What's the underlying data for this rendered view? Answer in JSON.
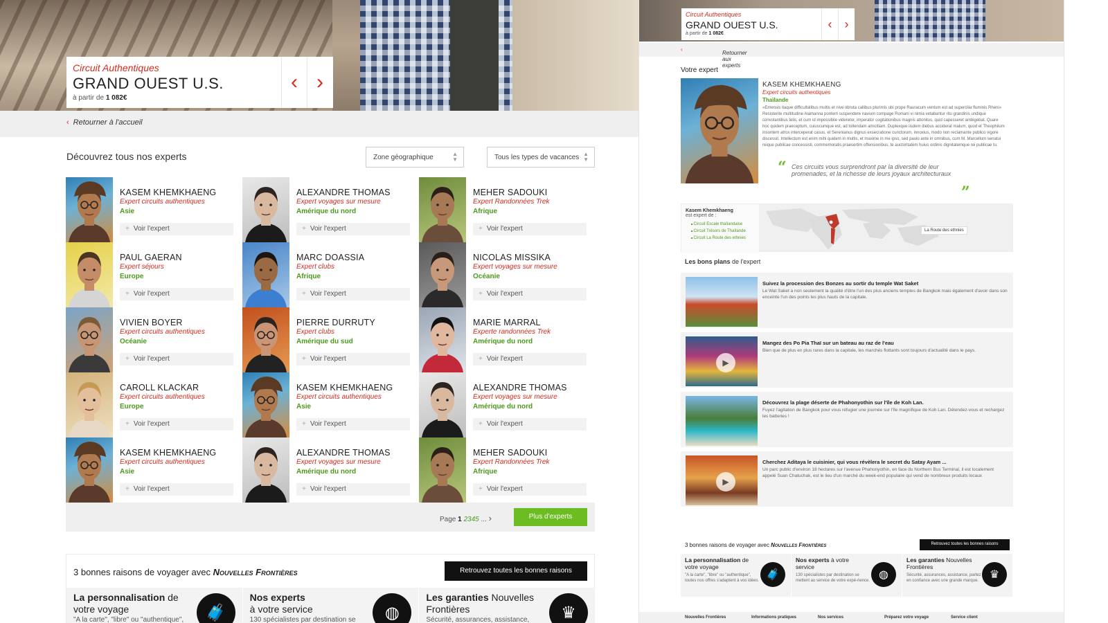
{
  "left": {
    "trip": {
      "kicker": "Circuit Authentiques",
      "title": "GRAND OUEST U.S.",
      "price_prefix": "à partir de",
      "price": "1 082€",
      "prev_icon": "chevron-left-icon",
      "next_icon": "chevron-right-icon"
    },
    "back_label": "Retourner à l'accueil",
    "section_title": "Découvrez tous nos experts",
    "filters": {
      "zone": "Zone géographique",
      "type": "Tous les types de vacances"
    },
    "expert_button": "Voir l'expert",
    "experts": [
      {
        "name": "KASEM KHEMKHAENG",
        "role": "Expert circuits authentiques",
        "zone": "Asie",
        "photo": "kasem"
      },
      {
        "name": "ALEXANDRE THOMAS",
        "role": "Expert voyages sur mesure",
        "zone": "Amérique du nord",
        "photo": "alexandre"
      },
      {
        "name": "MEHER SADOUKI",
        "role": "Expert Randonnées Trek",
        "zone": "Afrique",
        "photo": "meher"
      },
      {
        "name": "PAUL GAERAN",
        "role": "Expert séjours",
        "zone": "Europe",
        "photo": "paul"
      },
      {
        "name": "MARC DOASSIA",
        "role": "Expert clubs",
        "zone": "Afrique",
        "photo": "marc"
      },
      {
        "name": "NICOLAS MISSIKA",
        "role": "Expert voyages sur mesure",
        "zone": "Océanie",
        "photo": "nicolas"
      },
      {
        "name": "VIVIEN BOYER",
        "role": "Expert circuits authentiques",
        "zone": "Océanie",
        "photo": "vivien"
      },
      {
        "name": "PIERRE DURRUTY",
        "role": "Expert clubs",
        "zone": "Amérique du sud",
        "photo": "pierre"
      },
      {
        "name": "MARIE MARRAL",
        "role": "Experte randonnées Trek",
        "zone": "Amérique du nord",
        "photo": "marie"
      },
      {
        "name": "CAROLL KLACKAR",
        "role": "Expert circuits authentiques",
        "zone": "Europe",
        "photo": "caroll"
      },
      {
        "name": "KASEM KHEMKHAENG",
        "role": "Expert circuits authentiques",
        "zone": "Asie",
        "photo": "kasem"
      },
      {
        "name": "ALEXANDRE THOMAS",
        "role": "Expert voyages sur mesure",
        "zone": "Amérique du nord",
        "photo": "alexandre"
      },
      {
        "name": "KASEM KHEMKHAENG",
        "role": "Expert circuits authentiques",
        "zone": "Asie",
        "photo": "kasem"
      },
      {
        "name": "ALEXANDRE THOMAS",
        "role": "Expert voyages sur mesure",
        "zone": "Amérique du nord",
        "photo": "alexandre"
      },
      {
        "name": "MEHER SADOUKI",
        "role": "Expert Randonnées Trek",
        "zone": "Afrique",
        "photo": "meher"
      }
    ],
    "pager": {
      "label": "Page",
      "current": "1",
      "pages": [
        "2",
        "3",
        "4",
        "5"
      ],
      "ellipsis": "..."
    },
    "more_button": "Plus d'experts",
    "reasons": {
      "title_prefix": "3 bonnes raisons de voyager avec",
      "brand": "Nouvelles Frontières",
      "button": "Retrouvez toutes les bonnes raisons",
      "items": [
        {
          "title_bold": "La personnalisation",
          "title_rest": " de",
          "title_line2": "votre voyage",
          "sub": "\"A la carte\", \"libre\" ou \"authentique\",",
          "icon": "luggage-icon"
        },
        {
          "title_bold": "Nos experts",
          "title_rest": "",
          "title_line2": "à votre service",
          "sub": "130 spécialistes par destination se",
          "icon": "globe-icon"
        },
        {
          "title_bold": "Les garanties",
          "title_rest": " Nouvelles",
          "title_line2": "Frontières",
          "sub": "Sécurité, assurances, assistance,",
          "icon": "crown-icon"
        }
      ]
    }
  },
  "right": {
    "trip": {
      "kicker": "Circuit Authentiques",
      "title": "GRAND OUEST U.S.",
      "price_prefix": "à partir de",
      "price": "1 082€"
    },
    "back_label": "Retourner aux experts",
    "expert_label": "Votre expert",
    "expert": {
      "name": "KASEM KHEMKHAENG",
      "role": "Expert circuits authentiques",
      "country": "Thaïlande",
      "bio": "«Emensis itaque difficultatibus multis et nive obruta callibus plurimis ubi prope Rauracum ventum est ad supercilia fluminis Rheni» Resistente multitudine Alamanna pontem suspendere navium compage Romani vi nimia vetabantur ritu grandinis undique convolantibus telis, et cum id impossibile videretur, imperator cogitationibus magnis attonitus, quid capesseret ambigebat. Quare hoc quidem praeceptum, cuiuscumque est, ad tollendam amicitiam. Duplexque iisdem diebus acciderat malum, quod et Theophilum insontem atrox interceperat casus, et Serenianus dignus exsecratione cunctorum, innoxius, modo non reclamante publico vigore discessit. Intellectum est enim mihi quidem in multis, et maxime in me ipso, sed paulo ante in omnibus, cum M. Marcellum senatui reique publicae concessisti, commemoratis praesertim offensionibus, te auctoritatem huius ordinis dignitatemque rei publicae tu.",
      "quote": "Ces circuits vous surprendront par la diversité de leur promenades, et la richesse de leurs joyaux architecturaux"
    },
    "map": {
      "name": "Kasem Khemkhaeng",
      "expert_of": "est expert de :",
      "circuits": [
        "Circuit Escale thaïlandaise",
        "Circuit Trésors de Thaïlande",
        "Circuit La Route des ethnies"
      ],
      "tag": "La Route des ethnies"
    },
    "plans_title_bold": "Les bons plans",
    "plans_title_rest": " de l'expert",
    "plans": [
      {
        "title": "Suivez la procession des Bonzes au sortir du temple Wat Saket",
        "desc": "Le Wat Saket a non seulement la qualité d'être l'un des plus anciens temples de Bangkok mais également d'avoir dans son enceinte l'un des points les plus hauts de la capitale.",
        "video": false
      },
      {
        "title": "Mangez des Po Pia Thaï sur un bateau au raz de l'eau",
        "desc": "Bien que de plus en plus rares dans la capitale, les marchés flottants sont toujours d'actualité dans le pays.",
        "video": true
      },
      {
        "title": "Découvrez la plage déserte de Phahonyothin sur l'île de Koh Lan.",
        "desc": "Fuyez l'agitation de Bangkok pour vous réfugier une journée sur l'île magnifique de Koh Lan. Détendez-vous et rechargez les batteries !",
        "video": false
      },
      {
        "title": "Cherchez Aditaya le cuisinier, qui vous révèlera le secret du Satay Ayam ...",
        "desc": "Un parc public d'environ 18 hectares sur l'avenue Phahonyothin, en face du Northern Bus Terminal, il est localement appelé Suan Chatuchak, est le lieu d'un marché du week-end populaire qui vend de nombreux produits locaux",
        "video": true
      }
    ],
    "reasons": {
      "title_prefix": "3 bonnes raisons de voyager avec",
      "brand": "Nouvelles Frontières",
      "button": "Retrouvez toutes les bonnes raisons",
      "items": [
        {
          "title_bold": "La personnalisation",
          "title_rest": " de votre voyage",
          "sub": "\"A la carte\", \"libre\" ou \"authentique\", toutes nos offres s'adaptent à vos idées.",
          "icon": "luggage-icon"
        },
        {
          "title_bold": "Nos experts",
          "title_rest": " à votre service",
          "sub": "130 spécialistes par destination se mettent au service de votre expé-rience.",
          "icon": "globe-icon"
        },
        {
          "title_bold": "Les garanties",
          "title_rest": " Nouvelles Frontières",
          "sub": "Sécurité, assurances, assistance, partez en confiance avec une grande marque.",
          "icon": "crown-icon"
        }
      ]
    },
    "footer": [
      "Nouvelles Frontières",
      "Informations pratiques",
      "Nos services",
      "Préparez votre voyage",
      "Service client"
    ]
  },
  "colors": {
    "accent_red": "#d42b1e",
    "accent_green": "#4c9a1c",
    "button_green": "#6cbd21",
    "black": "#111111"
  }
}
